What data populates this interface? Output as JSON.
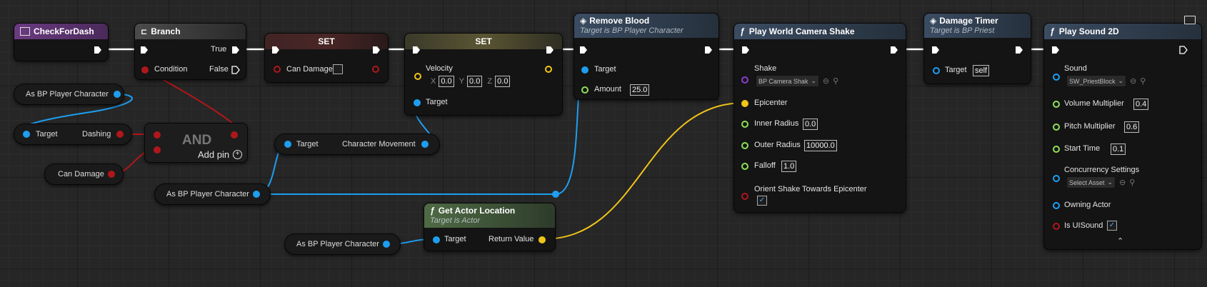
{
  "nodes": {
    "check_for_dash": {
      "title": "CheckForDash"
    },
    "branch": {
      "title": "Branch",
      "true_label": "True",
      "false_label": "False",
      "condition_label": "Condition"
    },
    "set1": {
      "title": "SET",
      "can_damage_label": "Can Damage"
    },
    "set2": {
      "title": "SET",
      "velocity_label": "Velocity",
      "x_label": "X",
      "x_value": "0.0",
      "y_label": "Y",
      "y_value": "0.0",
      "z_label": "Z",
      "z_value": "0.0",
      "target_label": "Target"
    },
    "remove_blood": {
      "title": "Remove Blood",
      "subtitle": "Target is BP Player Character",
      "target_label": "Target",
      "amount_label": "Amount",
      "amount_value": "25.0"
    },
    "camera_shake": {
      "title": "Play World Camera Shake",
      "shake_label": "Shake",
      "shake_value": "BP Camera Shak",
      "epicenter_label": "Epicenter",
      "inner_radius_label": "Inner Radius",
      "inner_radius_value": "0.0",
      "outer_radius_label": "Outer Radius",
      "outer_radius_value": "10000.0",
      "falloff_label": "Falloff",
      "falloff_value": "1.0",
      "orient_label": "Orient Shake Towards Epicenter"
    },
    "damage_timer": {
      "title": "Damage Timer",
      "subtitle": "Target is BP Priest",
      "target_label": "Target",
      "target_value": "self"
    },
    "play_sound": {
      "title": "Play Sound 2D",
      "sound_label": "Sound",
      "sound_value": "SW_PriestBlock",
      "volume_label": "Volume Multiplier",
      "volume_value": "0.4",
      "pitch_label": "Pitch Multiplier",
      "pitch_value": "0.6",
      "start_time_label": "Start Time",
      "start_time_value": "0.1",
      "concurrency_label": "Concurrency Settings",
      "concurrency_value": "Select Asset",
      "owning_actor_label": "Owning Actor",
      "is_ui_label": "Is UISound"
    },
    "and_node": {
      "title": "AND",
      "add_pin_label": "Add pin"
    },
    "get_actor_location": {
      "title": "Get Actor Location",
      "subtitle": "Target is Actor",
      "target_label": "Target",
      "return_label": "Return Value"
    },
    "char_movement": {
      "target_label": "Target",
      "output_label": "Character Movement"
    },
    "cast1": {
      "label": "As BP Player Character"
    },
    "dashing": {
      "target_label": "Target",
      "output_label": "Dashing"
    },
    "can_damage_getter": {
      "label": "Can Damage"
    },
    "cast2": {
      "label": "As BP Player Character"
    },
    "cast3": {
      "label": "As BP Player Character"
    }
  },
  "colors": {
    "exec": "#ffffff",
    "object": "#1e9ef0",
    "bool": "#b0171b",
    "float": "#8fe05a",
    "vector": "#f0c419",
    "class": "#8a3fd0"
  },
  "icons": {
    "function": "ƒ",
    "event": "event-icon",
    "branch": "branch-icon"
  }
}
